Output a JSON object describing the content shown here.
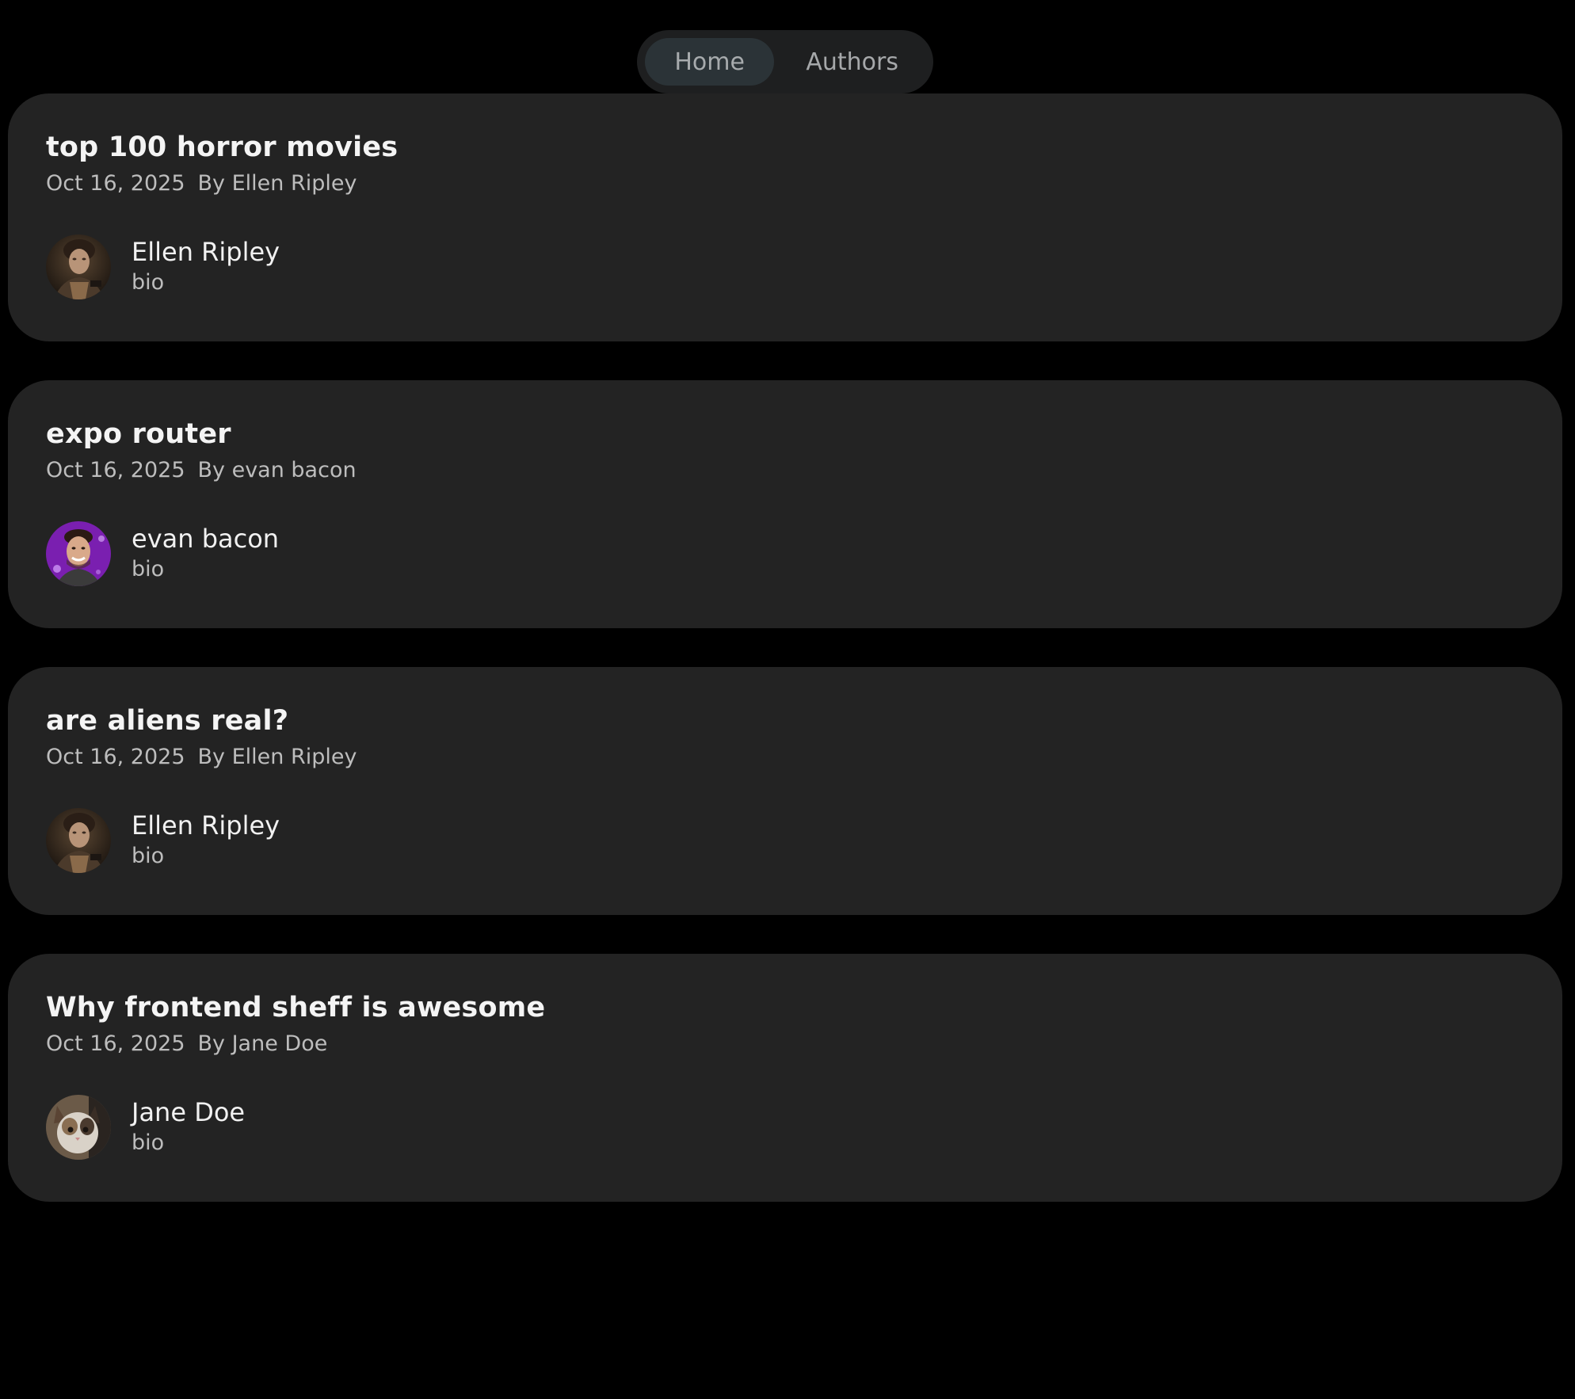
{
  "tabs": [
    {
      "label": "Home",
      "active": true
    },
    {
      "label": "Authors",
      "active": false
    }
  ],
  "posts": [
    {
      "title": "top 100 horror movies",
      "date": "Oct 16, 2025",
      "byline": "By Ellen Ripley",
      "author": {
        "name": "Ellen Ripley",
        "bio": "bio",
        "avatar": "ellen-ripley-avatar"
      }
    },
    {
      "title": "expo router",
      "date": "Oct 16, 2025",
      "byline": "By evan bacon",
      "author": {
        "name": "evan bacon",
        "bio": "bio",
        "avatar": "evan-bacon-avatar"
      }
    },
    {
      "title": "are aliens real?",
      "date": "Oct 16, 2025",
      "byline": "By Ellen Ripley",
      "author": {
        "name": "Ellen Ripley",
        "bio": "bio",
        "avatar": "ellen-ripley-avatar"
      }
    },
    {
      "title": "Why frontend sheff is awesome",
      "date": "Oct 16, 2025",
      "byline": "By Jane Doe",
      "author": {
        "name": "Jane Doe",
        "bio": "bio",
        "avatar": "jane-doe-avatar"
      }
    }
  ],
  "colors": {
    "background": "#000000",
    "card": "#232323",
    "tabbar": "#1e1f20",
    "active_tab": "#2b3337",
    "title_text": "#f4f4f4",
    "meta_text": "#bdbdbd"
  }
}
